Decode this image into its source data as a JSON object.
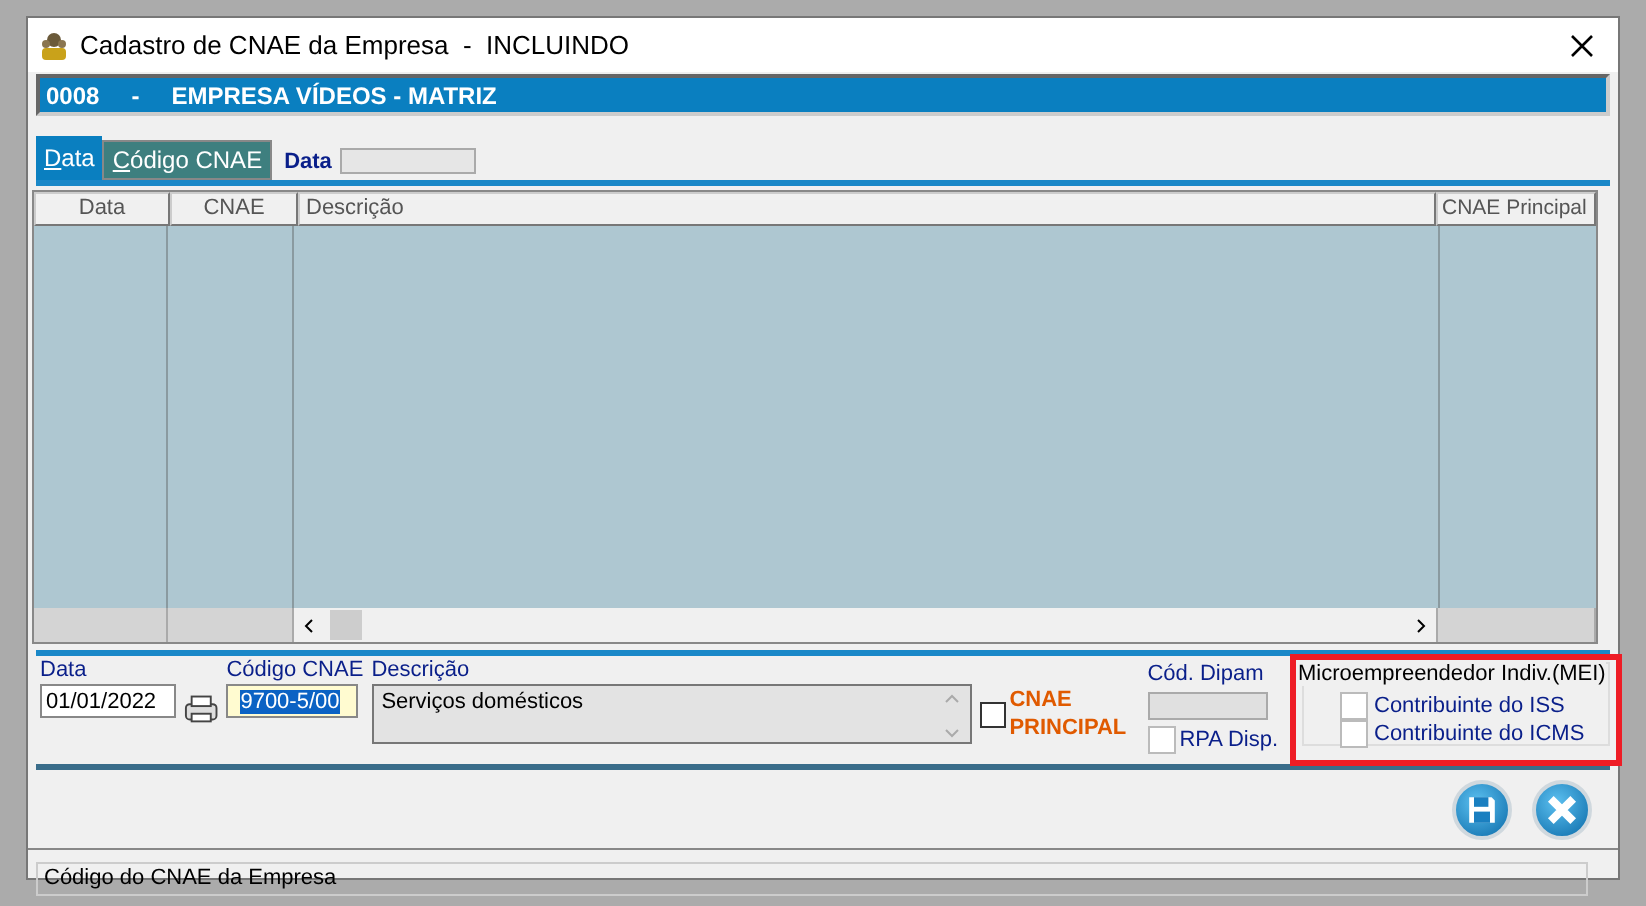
{
  "window": {
    "title": "Cadastro de CNAE da Empresa  -  INCLUINDO"
  },
  "company_bar": {
    "code": "0008",
    "separator": "-",
    "name": "EMPRESA VÍDEOS - MATRIZ"
  },
  "tabs": [
    {
      "label": "Data",
      "selected": true
    },
    {
      "label": "Código CNAE",
      "selected": false
    }
  ],
  "search": {
    "label": "Data"
  },
  "table": {
    "columns": [
      "Data",
      "CNAE",
      "Descrição",
      "CNAE Principal"
    ]
  },
  "form": {
    "date_label": "Data",
    "date_value": "01/01/2022",
    "code_label": "Código CNAE",
    "code_value": "9700-5/00",
    "description_label": "Descrição",
    "description_value": "Serviços domésticos",
    "principal_label": "CNAE PRINCIPAL",
    "principal_checked": false,
    "dipam_label": "Cód. Dipam",
    "rpa_label": "RPA Disp.",
    "rpa_checked": false
  },
  "mei": {
    "title": "Microempreendedor Indiv.(MEI)",
    "highlighted": true,
    "options": [
      {
        "label": "Contribuinte do ISS",
        "checked": false
      },
      {
        "label": "Contribuinte do ICMS",
        "checked": false
      }
    ]
  },
  "status_bar": "Código do CNAE da Empresa"
}
